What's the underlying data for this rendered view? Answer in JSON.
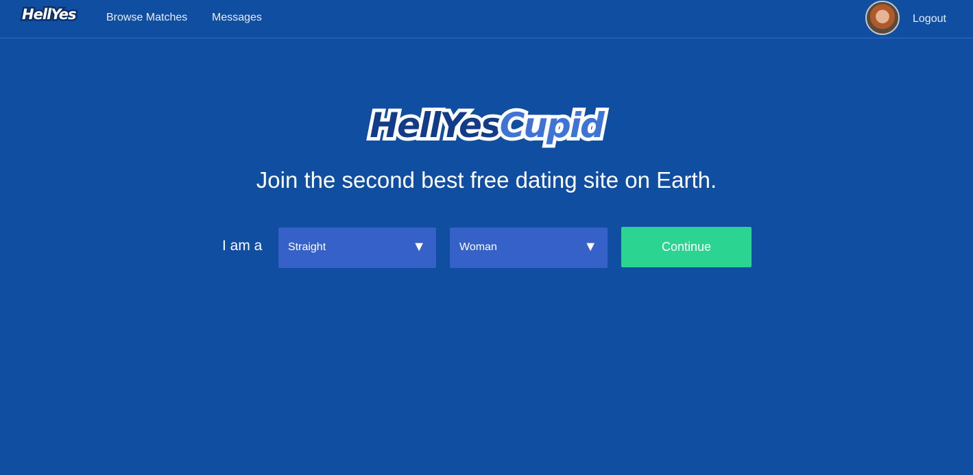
{
  "nav": {
    "logo": "HellYes",
    "links": [
      "Browse Matches",
      "Messages"
    ],
    "logout": "Logout"
  },
  "hero": {
    "logo_part1": "HellYes",
    "logo_part2": "Cupid",
    "tagline": "Join the second best free dating site on Earth."
  },
  "form": {
    "prefix": "I am a",
    "orientation": "Straight",
    "gender": "Woman",
    "dropdown_icon": "caret-down-icon",
    "continue": "Continue"
  },
  "colors": {
    "background": "#104ea2",
    "select_bg": "#3561c9",
    "continue_bg": "#2bd490",
    "logo_dark": "#123c8a",
    "logo_light": "#3f73d6"
  }
}
